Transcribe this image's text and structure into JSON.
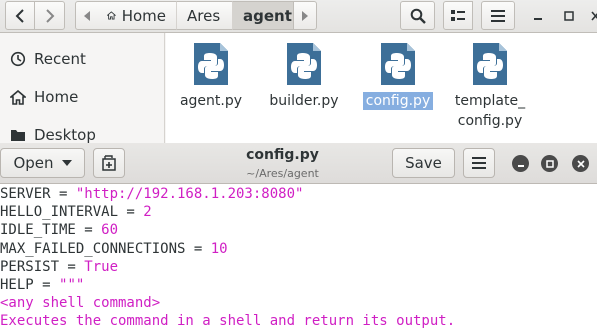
{
  "file_manager": {
    "breadcrumbs": [
      "Home",
      "Ares",
      "agent"
    ],
    "sidebar": [
      {
        "label": "Recent",
        "icon": "clock-icon"
      },
      {
        "label": "Home",
        "icon": "home-icon"
      },
      {
        "label": "Desktop",
        "icon": "folder-icon"
      }
    ],
    "files": [
      {
        "name": "agent.py",
        "icon": "python-file-icon",
        "selected": false
      },
      {
        "name": "builder.py",
        "icon": "python-file-icon",
        "selected": false
      },
      {
        "name": "config.py",
        "icon": "python-file-icon",
        "selected": true
      },
      {
        "name": "template_\nconfig.py",
        "icon": "python-file-icon",
        "selected": false
      }
    ]
  },
  "editor": {
    "open_label": "Open",
    "save_label": "Save",
    "title": "config.py",
    "subtitle": "~/Ares/agent",
    "code": [
      {
        "k": "SERVER = ",
        "v": "\"http://192.168.1.203:8080\""
      },
      {
        "k": "HELLO_INTERVAL = ",
        "v": "2"
      },
      {
        "k": "IDLE_TIME = ",
        "v": "60"
      },
      {
        "k": "MAX_FAILED_CONNECTIONS = ",
        "v": "10"
      },
      {
        "k": "PERSIST = ",
        "v": "True"
      },
      {
        "k": "HELP = ",
        "v": "\"\"\""
      },
      {
        "k": "",
        "v": "<any shell command>"
      },
      {
        "k": "",
        "v": "Executes the command in a shell and return its output."
      }
    ]
  },
  "colors": {
    "selection": "#86aee0",
    "string": "#d01fc4"
  }
}
